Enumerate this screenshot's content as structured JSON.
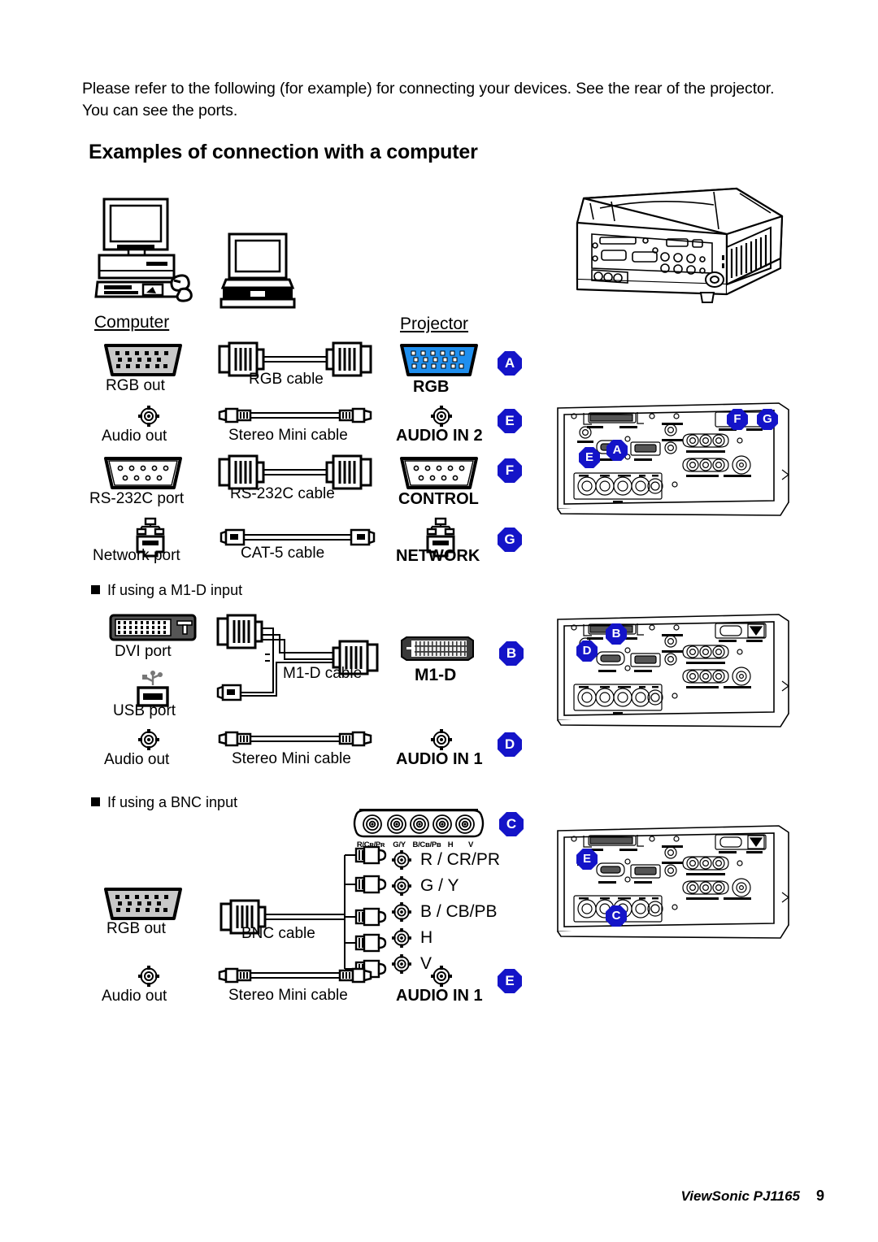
{
  "document": {
    "intro": "Please refer to the following (for example) for connecting your devices. See the rear of the projector. You can see the ports.",
    "heading": "Examples of connection with a computer",
    "footer_brand": "ViewSonic  PJ1165",
    "page_number": "9"
  },
  "columns": {
    "computer": "Computer",
    "projector": "Projector"
  },
  "colors": {
    "badge_blue": "#1414c8",
    "rgb_port_blue": "#1f8fef",
    "connector_gray": "#c8c8c8",
    "m1d_dark": "#3a3a3a"
  },
  "sections": [
    {
      "id": "main",
      "heading": null,
      "rows": [
        {
          "source_label": "RGB out",
          "source_icon": "dsub-15-gray-icon",
          "cable_label": "RGB cable",
          "cable_icon": "vga-cable-icon",
          "dest_label": "RGB",
          "dest_icon": "dsub-15-blue-icon",
          "badge": "A"
        },
        {
          "source_label": "Audio out",
          "source_icon": "stereo-mini-jack-icon",
          "cable_label": "Stereo Mini cable",
          "cable_icon": "stereo-mini-cable-icon",
          "dest_label": "AUDIO IN 2",
          "dest_icon": "stereo-mini-jack-icon",
          "badge": "E"
        },
        {
          "source_label": "RS-232C port",
          "source_icon": "dsub-9-icon",
          "cable_label": "RS-232C cable",
          "cable_icon": "serial-cable-icon",
          "dest_label": "CONTROL",
          "dest_icon": "dsub-9-icon",
          "badge": "F"
        },
        {
          "source_label": "Network port",
          "source_icon": "rj45-lan-icon",
          "cable_label": "CAT-5 cable",
          "cable_icon": "cat5-cable-icon",
          "dest_label": "NETWORK",
          "dest_icon": "rj45-lan-icon",
          "badge": "G"
        }
      ]
    },
    {
      "id": "m1d",
      "heading": "If using a M1-D input",
      "rows": [
        {
          "source_label": "DVI port",
          "source_icon": "dvi-port-icon",
          "source_label2": "USB port",
          "source_icon2": "usb-port-icon",
          "cable_label": "M1-D cable",
          "cable_icon": "m1d-cable-icon",
          "dest_label": "M1-D",
          "dest_icon": "m1d-connector-icon",
          "badge": "B"
        },
        {
          "source_label": "Audio out",
          "source_icon": "stereo-mini-jack-icon",
          "cable_label": "Stereo Mini cable",
          "cable_icon": "stereo-mini-cable-icon",
          "dest_label": "AUDIO IN 1",
          "dest_icon": "stereo-mini-jack-icon",
          "badge": "D"
        }
      ]
    },
    {
      "id": "bnc",
      "heading": "If using a BNC input",
      "bnc_block": {
        "badge": "C",
        "pin_labels": [
          "R/Cʀ/Pʀ",
          "G/Y",
          "B/Cʙ/Pʙ",
          "H",
          "V"
        ],
        "lines": [
          "R / CR/PR",
          "G / Y",
          "B / CB/PB",
          "H",
          "V"
        ]
      },
      "rows": [
        {
          "source_label": "RGB out",
          "source_icon": "dsub-15-gray-icon",
          "cable_label": "BNC cable",
          "cable_icon": "bnc-cable-icon",
          "dest_label": "",
          "badge": ""
        },
        {
          "source_label": "Audio out",
          "source_icon": "stereo-mini-jack-icon",
          "cable_label": "Stereo Mini cable",
          "cable_icon": "stereo-mini-cable-icon",
          "dest_label": "AUDIO IN 1",
          "dest_icon": "stereo-mini-jack-icon",
          "badge": "E"
        }
      ]
    }
  ],
  "rear_panels": [
    {
      "id": "panel-1",
      "badges": [
        "E",
        "A",
        "F",
        "G"
      ]
    },
    {
      "id": "panel-2",
      "badges": [
        "D",
        "B"
      ]
    },
    {
      "id": "panel-3",
      "badges": [
        "E",
        "C"
      ]
    }
  ]
}
